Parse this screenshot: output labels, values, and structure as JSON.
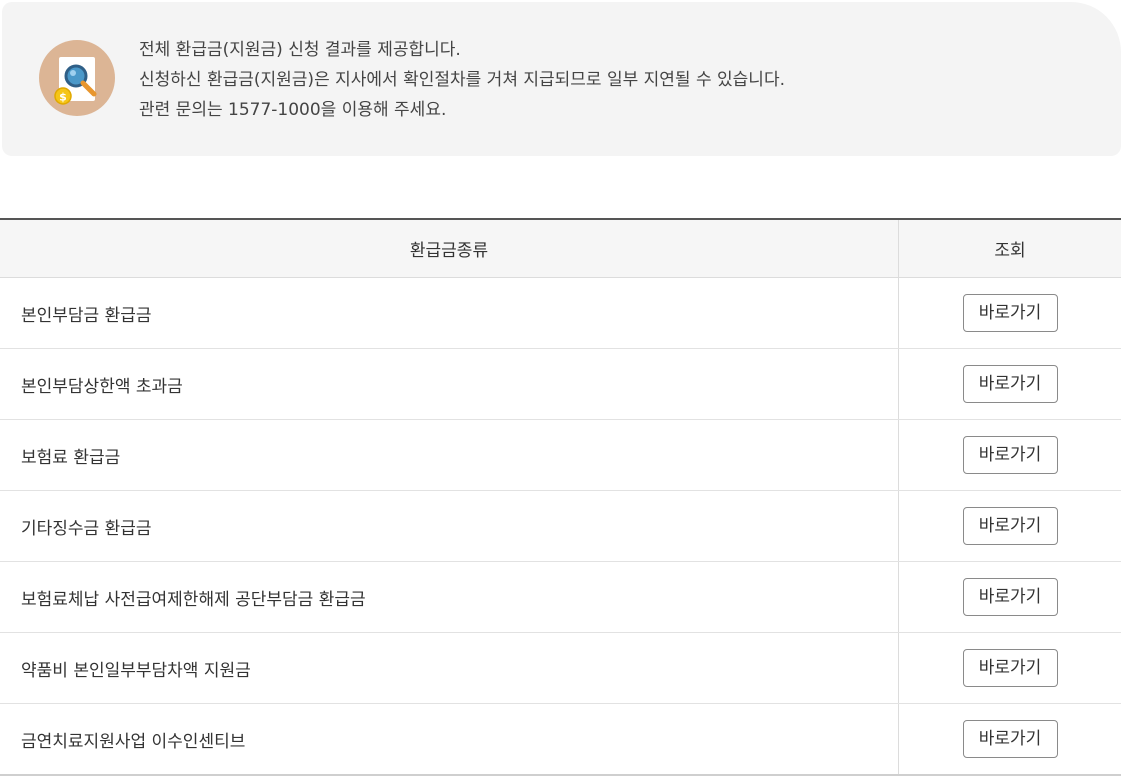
{
  "notice": {
    "icon": "refund-search-icon",
    "lines": [
      "전체 환급금(지원금) 신청 결과를 제공합니다.",
      "신청하신 환급금(지원금)은 지사에서 확인절차를 거쳐 지급되므로 일부 지연될 수 있습니다.",
      "관련 문의는 1577-1000을 이용해 주세요."
    ]
  },
  "table": {
    "headers": {
      "type": "환급금종류",
      "action": "조회"
    },
    "rows": [
      {
        "type": "본인부담금 환급금",
        "button": "바로가기"
      },
      {
        "type": "본인부담상한액 초과금",
        "button": "바로가기"
      },
      {
        "type": "보험료 환급금",
        "button": "바로가기"
      },
      {
        "type": "기타징수금 환급금",
        "button": "바로가기"
      },
      {
        "type": "보험료체납 사전급여제한해제 공단부담금 환급금",
        "button": "바로가기"
      },
      {
        "type": "약품비 본인일부부담차액 지원금",
        "button": "바로가기"
      },
      {
        "type": "금연치료지원사업 이수인센티브",
        "button": "바로가기"
      }
    ]
  },
  "colors": {
    "notice_bg": "#f4f4f4",
    "icon_circle": "#dcb595",
    "header_bg": "#f6f6f6",
    "table_top_border": "#555555"
  }
}
